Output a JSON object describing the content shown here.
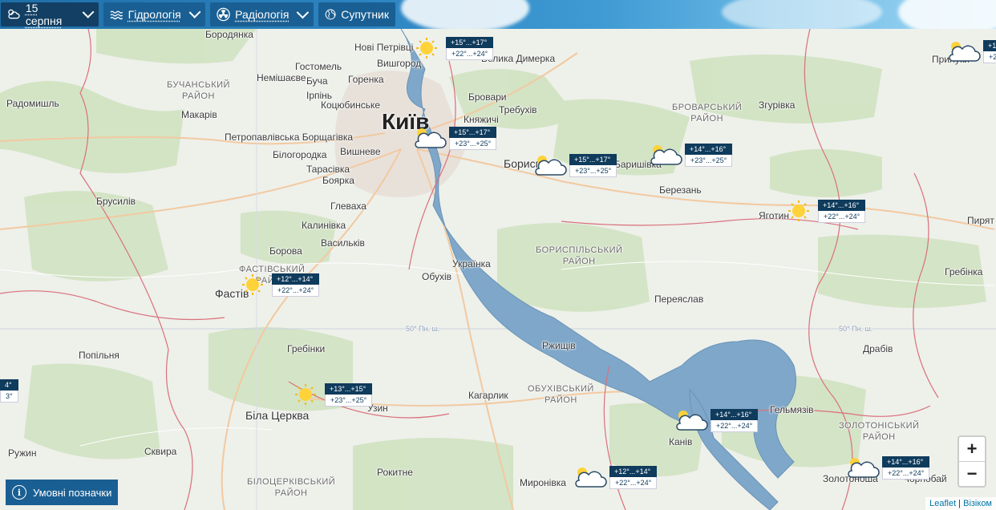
{
  "toolbar": {
    "date": "15 серпня",
    "hydrology": "Гідрологія",
    "radiology": "Радіологія",
    "satellite": "Супутник"
  },
  "places": [
    {
      "id": "borodianka",
      "name": "Бородянка"
    },
    {
      "id": "novi-petrivtsi",
      "name": "Нові Петрівці"
    },
    {
      "id": "vyshhorod",
      "name": "Вишгород"
    },
    {
      "id": "velyka-dymerka",
      "name": "Велика Димерка"
    },
    {
      "id": "hostomel",
      "name": "Гостомель"
    },
    {
      "id": "nemishaieve",
      "name": "Немішаєве"
    },
    {
      "id": "bucha",
      "name": "Буча"
    },
    {
      "id": "horenka",
      "name": "Горенка"
    },
    {
      "id": "brovary",
      "name": "Бровари"
    },
    {
      "id": "irpin",
      "name": "Ірпінь"
    },
    {
      "id": "kotsiubynske",
      "name": "Коцюбинське"
    },
    {
      "id": "radomyshl",
      "name": "Радомишль"
    },
    {
      "id": "makariv",
      "name": "Макарів"
    },
    {
      "id": "trebukhiv",
      "name": "Требухів"
    },
    {
      "id": "kniazhychi",
      "name": "Княжичі"
    },
    {
      "id": "kyiv",
      "name": "Київ"
    },
    {
      "id": "petropavlivska",
      "name": "Петропавлівська Борщагівка"
    },
    {
      "id": "vyshneve",
      "name": "Вишневе"
    },
    {
      "id": "bilohorodka",
      "name": "Білогородка"
    },
    {
      "id": "tarasivka",
      "name": "Тарасівка"
    },
    {
      "id": "boiarka",
      "name": "Боярка"
    },
    {
      "id": "boryspil",
      "name": "Борисп"
    },
    {
      "id": "baryshivka",
      "name": "Баришівка"
    },
    {
      "id": "zghurivka",
      "name": "Згурівка"
    },
    {
      "id": "berezan",
      "name": "Березань"
    },
    {
      "id": "brusyliv",
      "name": "Брусилів"
    },
    {
      "id": "hlevakha",
      "name": "Глеваха"
    },
    {
      "id": "yahotyn",
      "name": "Яготин"
    },
    {
      "id": "kalynivka",
      "name": "Калинівка"
    },
    {
      "id": "vasylkiv",
      "name": "Васильків"
    },
    {
      "id": "pyriatyn",
      "name": "Пирят"
    },
    {
      "id": "borova",
      "name": "Борова"
    },
    {
      "id": "ukrainka",
      "name": "Українка"
    },
    {
      "id": "hrebinka",
      "name": "Гребінка"
    },
    {
      "id": "obukhiv",
      "name": "Обухів"
    },
    {
      "id": "fastiv",
      "name": "Фастів"
    },
    {
      "id": "pereiaslav",
      "name": "Переяслав"
    },
    {
      "id": "popilnia",
      "name": "Попільня"
    },
    {
      "id": "rzhyshchiv",
      "name": "Ржищів"
    },
    {
      "id": "drabiv",
      "name": "Драбів"
    },
    {
      "id": "hrebinky",
      "name": "Гребінки"
    },
    {
      "id": "kaharlyk",
      "name": "Кагарлик"
    },
    {
      "id": "uzyn",
      "name": "Узин"
    },
    {
      "id": "bila-tserkva",
      "name": "Біла Церква"
    },
    {
      "id": "helmiaziv",
      "name": "Гельмязів"
    },
    {
      "id": "kaniv",
      "name": "Канів"
    },
    {
      "id": "ruzhyn",
      "name": "Ружин"
    },
    {
      "id": "skvyra",
      "name": "Сквира"
    },
    {
      "id": "rokytne",
      "name": "Рокитне"
    },
    {
      "id": "myronivka",
      "name": "Миронівка"
    },
    {
      "id": "zolotonosha",
      "name": "Золотоноша"
    },
    {
      "id": "chornobai",
      "name": "Чорнобай"
    },
    {
      "id": "pryluky",
      "name": "Прилуки"
    }
  ],
  "districts": [
    {
      "id": "buchanskyi",
      "name": "БУЧАНСЬКИЙ\nРАЙОН"
    },
    {
      "id": "brovarskyi",
      "name": "БРОВАРСЬКИЙ\nРАЙОН"
    },
    {
      "id": "boryspilskyi",
      "name": "БОРИСПІЛЬСЬКИЙ\nРАЙОН"
    },
    {
      "id": "fastivskyi",
      "name": "ФАСТІВСЬКИЙ\nРАЙОН"
    },
    {
      "id": "obukhivskyi",
      "name": "ОБУХІВСЬКИЙ\nРАЙОН"
    },
    {
      "id": "zolotoniskyi",
      "name": "ЗОЛОТОНІСЬКИЙ\nРАЙОН"
    },
    {
      "id": "bilotserkivskyi",
      "name": "БІЛОЦЕРКІВСЬКИЙ\nРАЙОН"
    }
  ],
  "grid_labels": [
    "50° Пн. ш.",
    "50° Пн. ш."
  ],
  "forecasts": [
    {
      "id": "vyshhorod",
      "icon": "sun-icon",
      "night": "+15°...+17°",
      "day": "+22°...+24°"
    },
    {
      "id": "kyiv",
      "icon": "partly-cloudy-icon",
      "night": "+15°...+17°",
      "day": "+23°...+25°"
    },
    {
      "id": "boryspil",
      "icon": "partly-cloudy-icon",
      "night": "+15°...+17°",
      "day": "+23°...+25°"
    },
    {
      "id": "baryshivka",
      "icon": "partly-cloudy-icon",
      "night": "+14°...+16°",
      "day": "+23°...+25°"
    },
    {
      "id": "yahotyn",
      "icon": "sun-icon",
      "night": "+14°...+16°",
      "day": "+22°...+24°"
    },
    {
      "id": "fastiv",
      "icon": "sun-icon",
      "night": "+12°...+14°",
      "day": "+22°...+24°"
    },
    {
      "id": "bila-tserkva",
      "icon": "sun-icon",
      "night": "+13°...+15°",
      "day": "+23°...+25°"
    },
    {
      "id": "kaniv",
      "icon": "partly-cloudy-icon",
      "night": "+14°...+16°",
      "day": "+22°...+24°"
    },
    {
      "id": "myronivka",
      "icon": "partly-cloudy-icon",
      "night": "+12°...+14°",
      "day": "+22°...+24°"
    },
    {
      "id": "zolotonosha",
      "icon": "partly-cloudy-icon",
      "night": "+14°...+16°",
      "day": "+22°...+24°"
    },
    {
      "id": "pryluky",
      "icon": "partly-cloudy-icon",
      "night": "+1",
      "day": "+2"
    },
    {
      "id": "west-edge",
      "icon": "none",
      "night": "4°",
      "day": "3°"
    }
  ],
  "zoom": {
    "in": "+",
    "out": "−"
  },
  "legend": {
    "label": "Умовні позначки",
    "icon": "i"
  },
  "attribution": {
    "leaflet": "Leaflet",
    "separator": " | ",
    "visicom": "Візіком"
  }
}
